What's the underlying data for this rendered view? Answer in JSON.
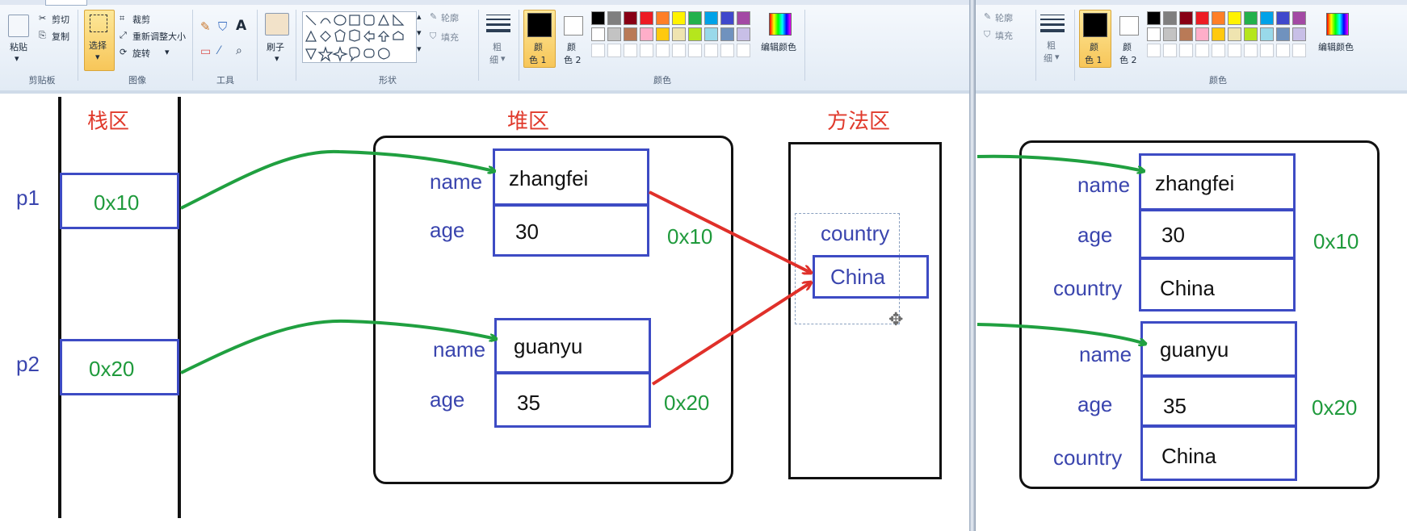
{
  "ribbon": {
    "clipboard": {
      "paste": "粘贴",
      "cut": "剪切",
      "copy": "复制",
      "group": "剪贴板"
    },
    "image": {
      "select": "选择",
      "crop": "裁剪",
      "resize": "重新调整大小",
      "rotate": "旋转",
      "group": "图像"
    },
    "tools": {
      "group": "工具",
      "text_tool": "A"
    },
    "brushes": {
      "label": "刷子"
    },
    "shapes": {
      "group": "形状",
      "outline": "轮廓",
      "fill": "填充"
    },
    "size": {
      "label_1": "粗",
      "label_2": "细"
    },
    "colors": {
      "color1_a": "颜",
      "color1_b": "色 1",
      "color2_a": "颜",
      "color2_b": "色 2",
      "edit": "编辑颜色",
      "group": "颜色",
      "row1": [
        "#000000",
        "#7f7f7f",
        "#880015",
        "#ed1c24",
        "#ff7f27",
        "#fff200",
        "#22b14c",
        "#00a2e8",
        "#3f48cc",
        "#a349a4"
      ],
      "row2": [
        "#ffffff",
        "#c3c3c3",
        "#b97a57",
        "#ffaec9",
        "#ffc90e",
        "#efe4b0",
        "#b5e61d",
        "#99d9ea",
        "#7092be",
        "#c8bfe7"
      ]
    }
  },
  "diagram_left": {
    "stack_title": "栈区",
    "heap_title": "堆区",
    "method_title": "方法区",
    "p1": "p1",
    "p2": "p2",
    "p1_value": "0x10",
    "p2_value": "0x20",
    "obj1": {
      "name_label": "name",
      "name_value": "zhangfei",
      "age_label": "age",
      "age_value": "30",
      "addr": "0x10"
    },
    "obj2": {
      "name_label": "name",
      "name_value": "guanyu",
      "age_label": "age",
      "age_value": "35",
      "addr": "0x20"
    },
    "static_field": {
      "label": "country",
      "value": "China"
    }
  },
  "diagram_right": {
    "obj1": {
      "name_label": "name",
      "name_value": "zhangfei",
      "age_label": "age",
      "age_value": "30",
      "country_label": "country",
      "country_value": "China",
      "addr": "0x10"
    },
    "obj2": {
      "name_label": "name",
      "name_value": "guanyu",
      "age_label": "age",
      "age_value": "35",
      "country_label": "country",
      "country_value": "China",
      "addr": "0x20"
    }
  }
}
